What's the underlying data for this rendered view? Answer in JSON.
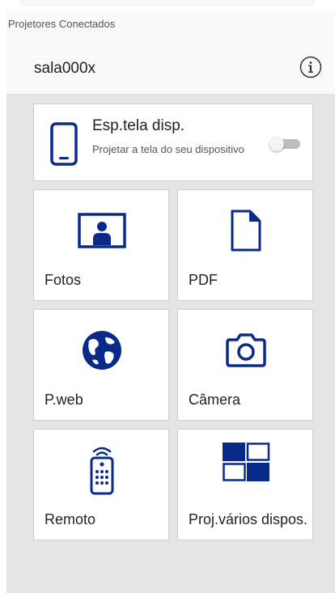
{
  "header": {
    "connected_label": "Projetores Conectados",
    "projector_name": "sala000x"
  },
  "mirror": {
    "title": "Esp.tela disp.",
    "subtitle": "Projetar a tela do seu dispositivo",
    "enabled": false
  },
  "tiles": [
    {
      "label": "Fotos",
      "icon": "photo-icon"
    },
    {
      "label": "PDF",
      "icon": "document-icon"
    },
    {
      "label": "P.web",
      "icon": "globe-icon"
    },
    {
      "label": "Câmera",
      "icon": "camera-icon"
    },
    {
      "label": "Remoto",
      "icon": "remote-control-icon"
    },
    {
      "label": "Proj.vários dispos.",
      "icon": "multi-screen-icon"
    }
  ],
  "colors": {
    "accent": "#0a2a8a",
    "background": "#e5e5e5",
    "card": "#ffffff"
  }
}
